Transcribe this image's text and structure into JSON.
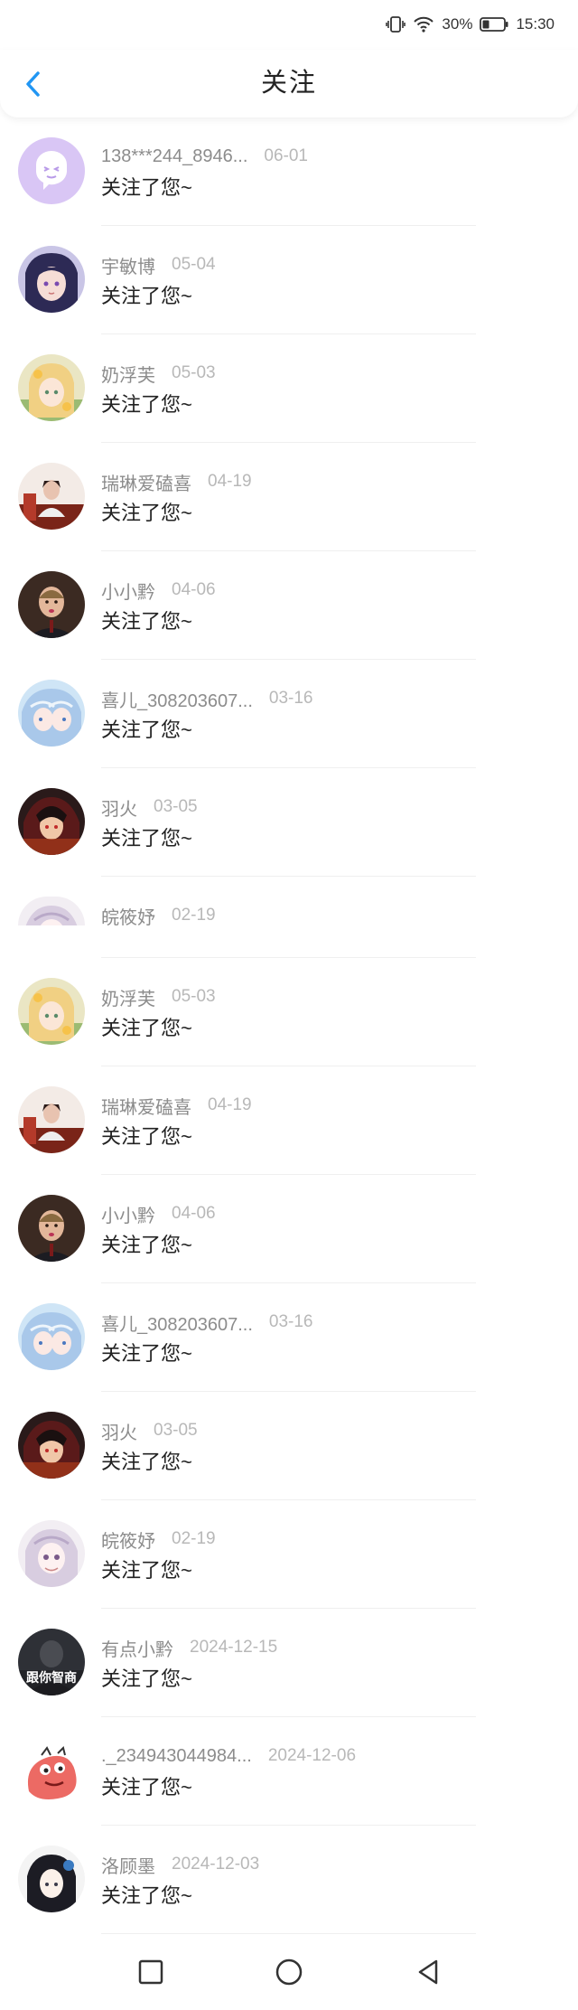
{
  "status_bar": {
    "battery": "30%",
    "time": "15:30",
    "icons": [
      "vibrate-icon",
      "wifi-icon",
      "battery-icon"
    ]
  },
  "header": {
    "title": "关注",
    "back_icon": "chevron-left-icon",
    "accent": "#2196f3"
  },
  "notifications": [
    {
      "name": "138***244_8946...",
      "date": "06-01",
      "message": "关注了您~",
      "avatar": "default"
    },
    {
      "name": "宇敏博",
      "date": "05-04",
      "message": "关注了您~",
      "avatar": "anime-purple"
    },
    {
      "name": "奶浮芙",
      "date": "05-03",
      "message": "关注了您~",
      "avatar": "anime-blonde"
    },
    {
      "name": "瑞琳爱磕喜",
      "date": "04-19",
      "message": "关注了您~",
      "avatar": "photo-red"
    },
    {
      "name": "小小黔",
      "date": "04-06",
      "message": "关注了您~",
      "avatar": "photo-man"
    },
    {
      "name": "喜儿_308203607...",
      "date": "03-16",
      "message": "关注了您~",
      "avatar": "anime-blue"
    },
    {
      "name": "羽火",
      "date": "03-05",
      "message": "关注了您~",
      "avatar": "anime-dark"
    },
    {
      "name": "皖筱妤",
      "date": "02-19",
      "message": "",
      "avatar": "anime-white"
    },
    {
      "name": "奶浮芙",
      "date": "05-03",
      "message": "关注了您~",
      "avatar": "anime-blonde"
    },
    {
      "name": "瑞琳爱磕喜",
      "date": "04-19",
      "message": "关注了您~",
      "avatar": "photo-red"
    },
    {
      "name": "小小黔",
      "date": "04-06",
      "message": "关注了您~",
      "avatar": "photo-man"
    },
    {
      "name": "喜儿_308203607...",
      "date": "03-16",
      "message": "关注了您~",
      "avatar": "anime-blue"
    },
    {
      "name": "羽火",
      "date": "03-05",
      "message": "关注了您~",
      "avatar": "anime-dark"
    },
    {
      "name": "皖筱妤",
      "date": "02-19",
      "message": "关注了您~",
      "avatar": "anime-white"
    },
    {
      "name": "有点小黔",
      "date": "2024-12-15",
      "message": "关注了您~",
      "avatar": "photo-dark",
      "avatar_text": "跟你智商"
    },
    {
      "name": "._234943044984...",
      "date": "2024-12-06",
      "message": "关注了您~",
      "avatar": "cartoon-red"
    },
    {
      "name": "洛顾墨",
      "date": "2024-12-03",
      "message": "关注了您~",
      "avatar": "anime-mono"
    }
  ],
  "system_nav": {
    "icons": [
      "recent-apps-icon",
      "home-icon",
      "back-triangle-icon"
    ]
  }
}
